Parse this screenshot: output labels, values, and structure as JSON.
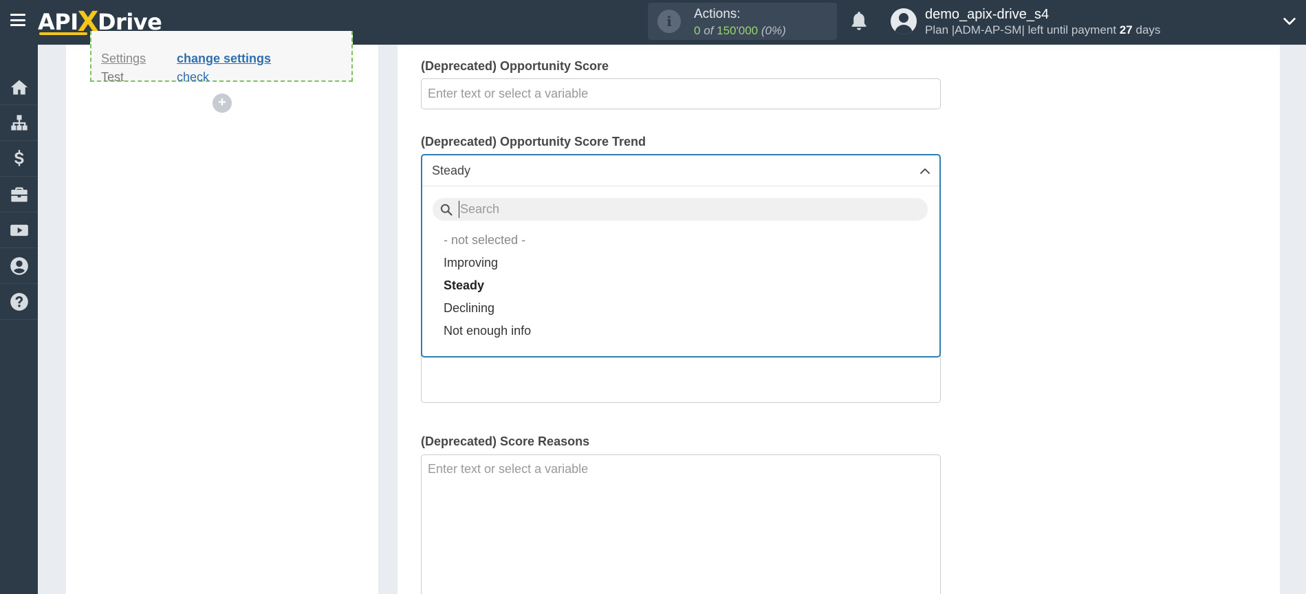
{
  "app": {
    "logo_left": "API",
    "logo_x": "X",
    "logo_right": "Drive"
  },
  "header": {
    "actions_label": "Actions:",
    "actions_used": "0",
    "actions_of": "of",
    "actions_total": "150'000",
    "actions_percent": "(0%)",
    "user_name": "demo_apix-drive_s4",
    "plan_prefix": "Plan |ADM-AP-SM| left until payment",
    "plan_days": "27",
    "plan_suffix": "days"
  },
  "sidebar": {
    "items": [
      {
        "icon": "home-icon"
      },
      {
        "icon": "sitemap-icon"
      },
      {
        "icon": "dollar-icon"
      },
      {
        "icon": "briefcase-icon"
      },
      {
        "icon": "youtube-icon"
      },
      {
        "icon": "user-circle-icon"
      },
      {
        "icon": "question-circle-icon"
      }
    ]
  },
  "left_panel": {
    "rows": [
      {
        "key": "Settings",
        "value": "change settings"
      },
      {
        "key": "Test",
        "value": "check"
      }
    ],
    "add_symbol": "+"
  },
  "form": {
    "opportunity_score": {
      "label": "(Deprecated) Opportunity Score",
      "placeholder": "Enter text or select a variable"
    },
    "opportunity_score_trend": {
      "label": "(Deprecated) Opportunity Score Trend",
      "selected": "Steady",
      "search_placeholder": "Search",
      "options": [
        "- not selected -",
        "Improving",
        "Steady",
        "Declining",
        "Not enough info"
      ]
    },
    "score_reasons": {
      "label": "(Deprecated) Score Reasons",
      "placeholder": "Enter text or select a variable"
    }
  },
  "colors": {
    "topbar": "#2d3a48",
    "accent_yellow": "#f5c518",
    "accent_green": "#9bd46a",
    "select_border": "#2e7fb0",
    "link_blue": "#2e6fae"
  }
}
